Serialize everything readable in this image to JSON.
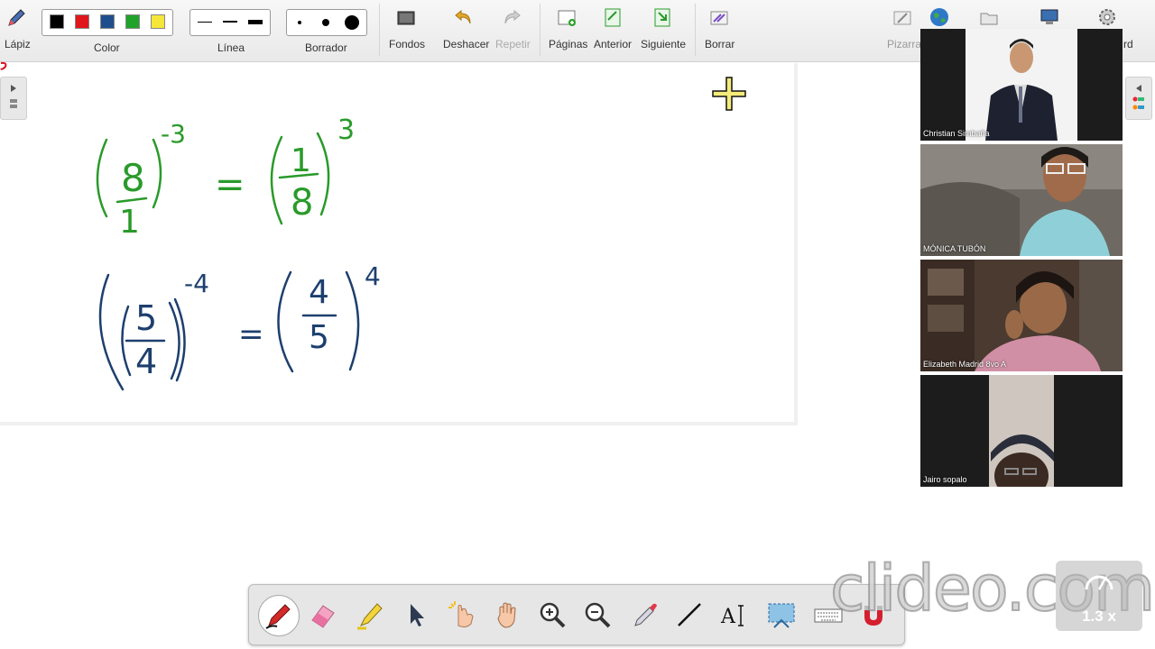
{
  "toolbar": {
    "pencil_label": "Lápiz",
    "color_label": "Color",
    "line_label": "Línea",
    "eraser_label": "Borrador",
    "backgrounds_label": "Fondos",
    "undo_label": "Deshacer",
    "redo_label": "Repetir",
    "pages_label": "Páginas",
    "previous_label": "Anterior",
    "next_label": "Siguiente",
    "clear_label": "Borrar",
    "whiteboard_label": "Pizarra",
    "board_label": "rd",
    "colors": [
      "#000000",
      "#e0161d",
      "#1f4e8c",
      "#1fa32b",
      "#f5e63a"
    ]
  },
  "canvas": {
    "eq1": {
      "base_num": "8",
      "base_den": "1",
      "exp_left": "-3",
      "equals": "=",
      "res_num": "1",
      "res_den": "8",
      "exp_right": "3",
      "ink": "#2a9a2a"
    },
    "eq2": {
      "base_num": "5",
      "base_den": "4",
      "exp_left": "-4",
      "equals": "=",
      "res_num": "4",
      "res_den": "5",
      "exp_right": "4",
      "ink": "#1d3f6e"
    }
  },
  "participants": [
    {
      "name": "Christian Simbaña"
    },
    {
      "name": "MÓNICA TUBÓN"
    },
    {
      "name": "Elizabeth Madrid 8vo A"
    },
    {
      "name": "Jairo sopalo"
    }
  ],
  "bottom_tools": [
    "pen-tool",
    "eraser-tool",
    "highlighter-tool",
    "select-tool",
    "magic-pointer-tool",
    "pan-tool",
    "zoom-in-tool",
    "zoom-out-tool",
    "eyedropper-tool",
    "line-tool",
    "text-tool",
    "screenshot-tool",
    "keyboard-tool",
    "magnet-tool"
  ],
  "watermark": "clideo.com",
  "speed": "1.3 x"
}
